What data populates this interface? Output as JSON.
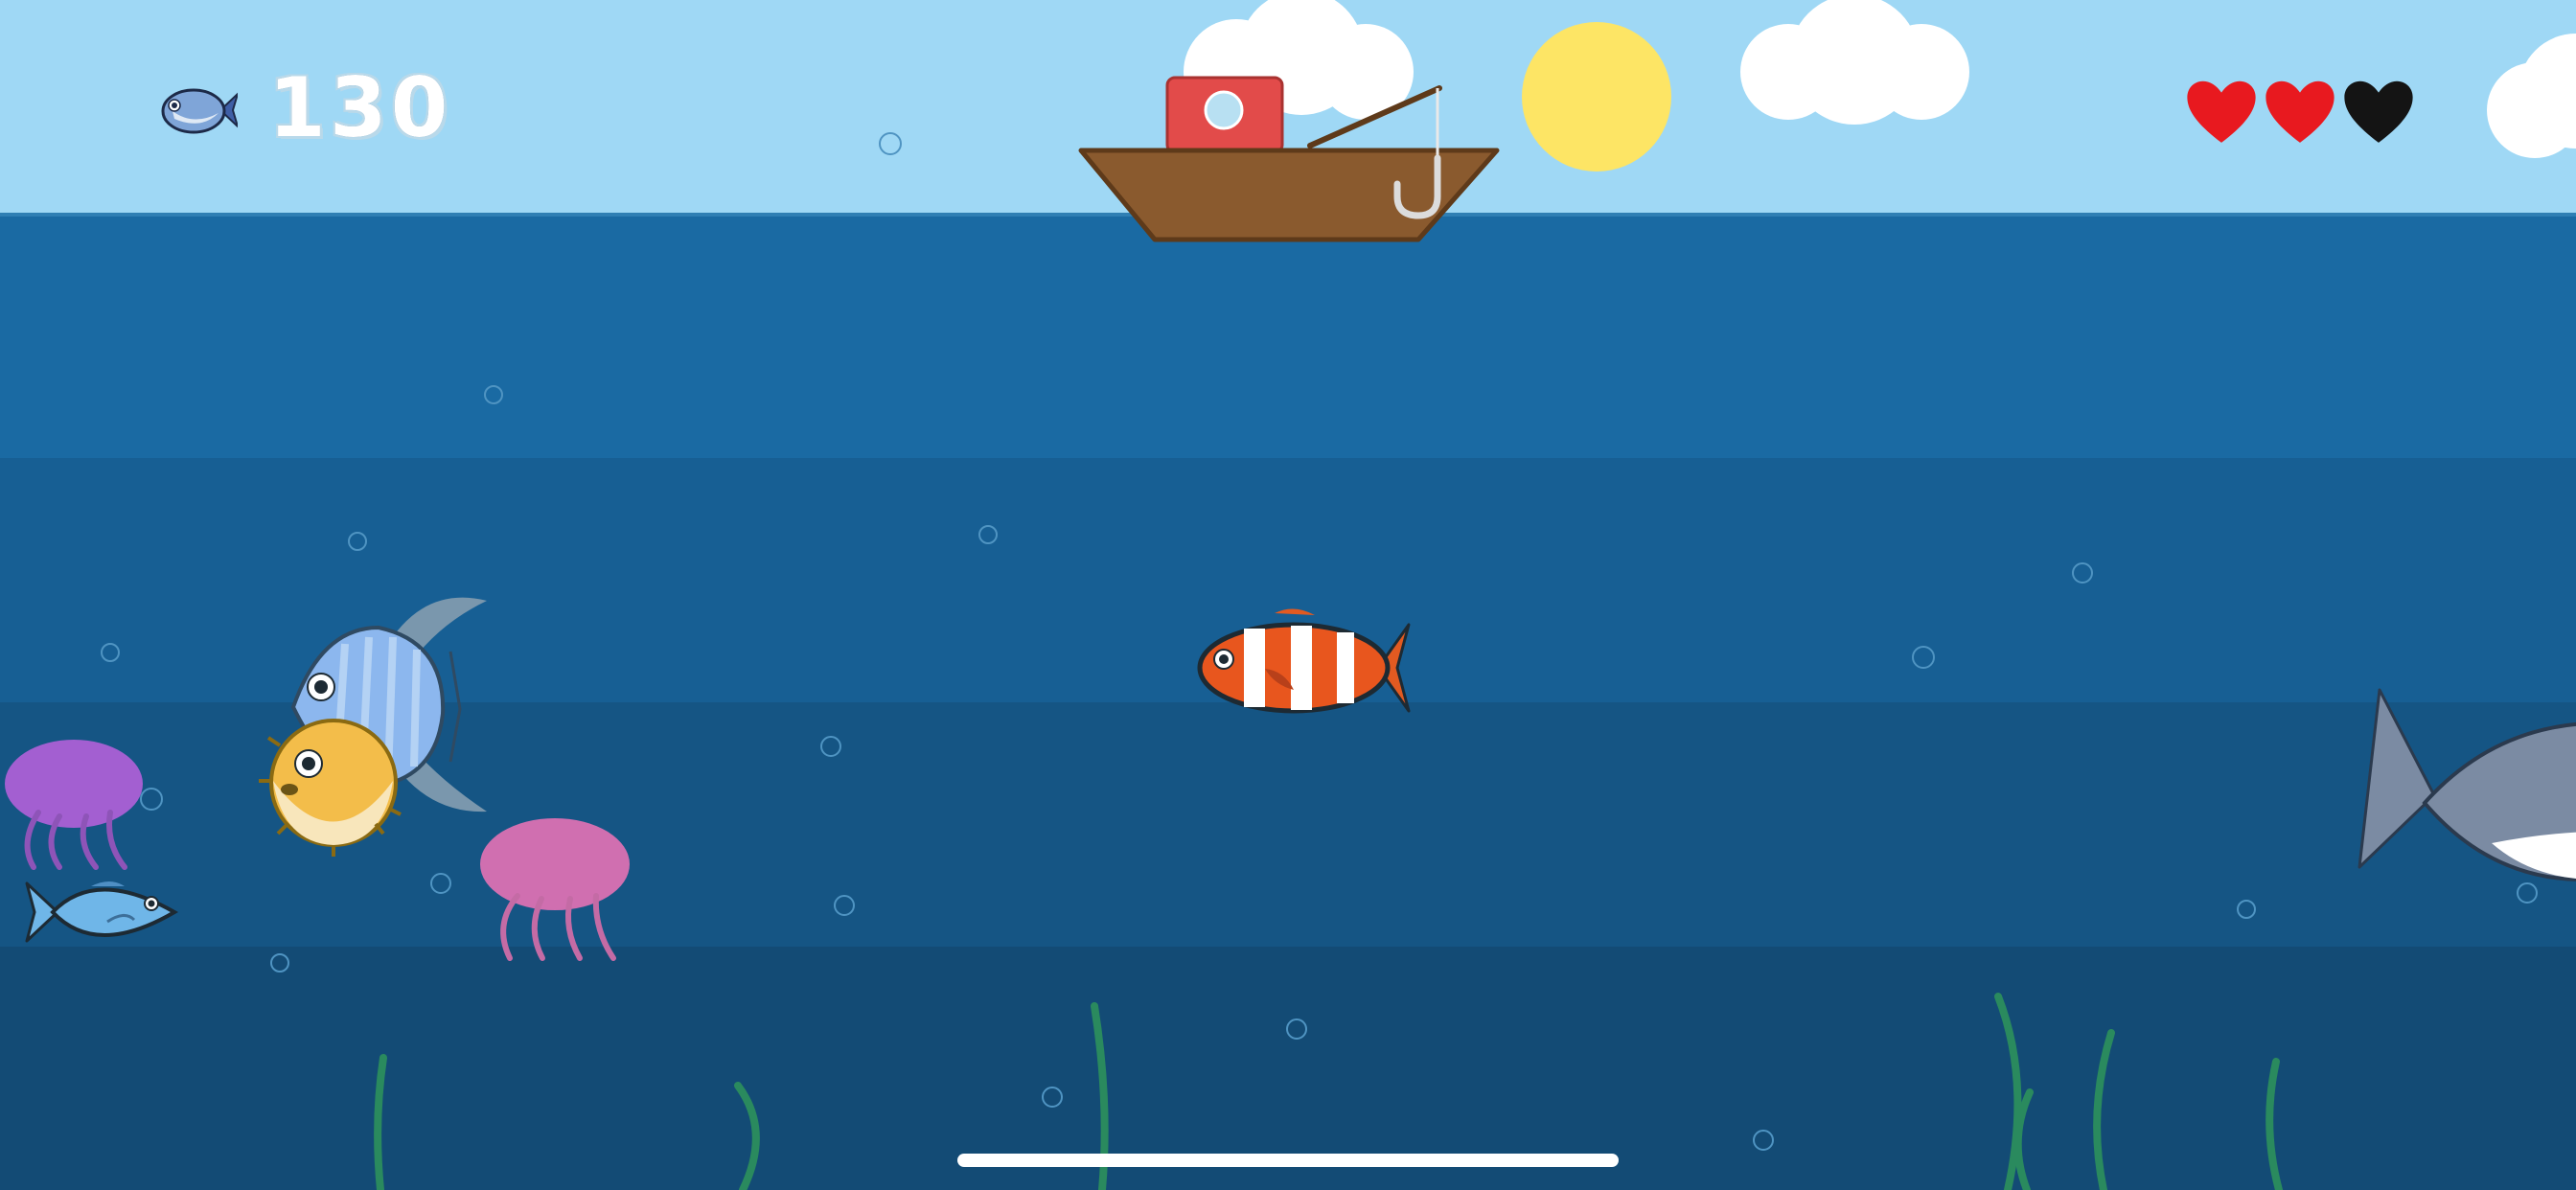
{
  "hud": {
    "score": "130",
    "score_icon": "fish-icon",
    "lives": [
      {
        "icon": "heart-icon",
        "state": "full",
        "color": "#e8191f"
      },
      {
        "icon": "heart-icon",
        "state": "full",
        "color": "#e8191f"
      },
      {
        "icon": "heart-icon",
        "state": "empty",
        "color": "#141414"
      }
    ]
  },
  "colors": {
    "sky": "#9fd8f5",
    "water_top": "#1a6aa3",
    "water_mid": "#175f94",
    "water_low": "#155584",
    "water_deep": "#134b75",
    "sun": "#fde565",
    "boat": "#8a5a2e",
    "seaweed": "#2a8a5e"
  },
  "creatures": [
    {
      "kind": "clownfish",
      "icon": "clownfish-icon"
    },
    {
      "kind": "sunfish",
      "icon": "sunfish-icon"
    },
    {
      "kind": "pufferfish",
      "icon": "pufferfish-icon"
    },
    {
      "kind": "jellyfish",
      "color": "#a35fd1",
      "icon": "purple-jellyfish-icon"
    },
    {
      "kind": "jellyfish",
      "color": "#d06fb0",
      "icon": "pink-jellyfish-icon"
    },
    {
      "kind": "small fish",
      "icon": "blue-fish-icon"
    },
    {
      "kind": "shark",
      "icon": "shark-icon"
    }
  ]
}
